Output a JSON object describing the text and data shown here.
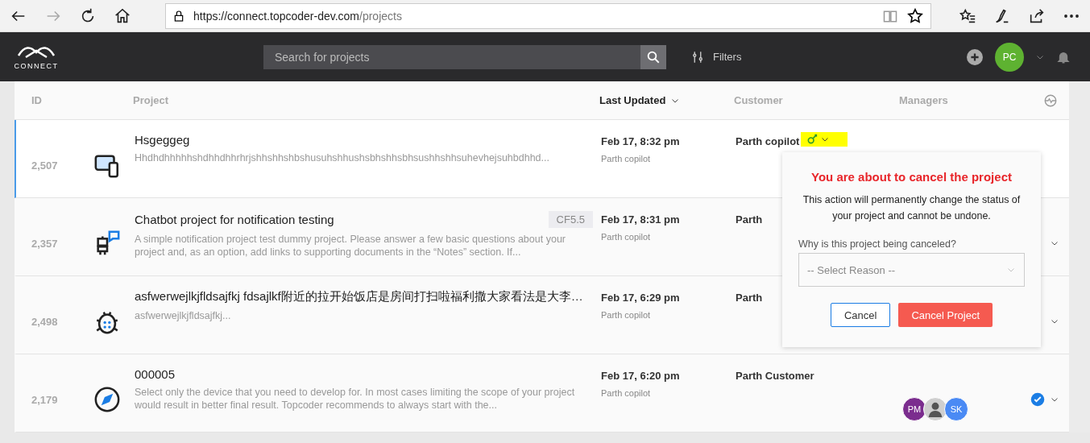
{
  "browser": {
    "url_host": "https://connect.topcoder-dev.com",
    "url_path": "/projects",
    "forward_disabled": true
  },
  "header": {
    "logo_text": "CONNECT",
    "search": {
      "placeholder": "Search for projects"
    },
    "filters_label": "Filters",
    "user_initials": "PC"
  },
  "table": {
    "columns": [
      {
        "label": "ID",
        "sorted": false
      },
      {
        "label": "Project",
        "sorted": false
      },
      {
        "label": "Last Updated",
        "sorted": true
      },
      {
        "label": "Customer",
        "sorted": false
      },
      {
        "label": "Managers",
        "sorted": false
      }
    ],
    "rows": [
      {
        "id": "2,507",
        "kind": "devices",
        "title": "Hsgeggeg",
        "description": "Hhdhdhhhhhshdhhdhhrhrjshhshhshbshusuhshhushsbhshhsbhsushhshhsuhevhejsuhbdhhd...",
        "updated": "Feb 17, 8:32 pm",
        "updated_by": "Parth copilot",
        "customer": "Parth copilot",
        "selected": true,
        "highlight_menu": true,
        "caret": false,
        "verified": false
      },
      {
        "id": "2,357",
        "kind": "chatbot",
        "title": "Chatbot project for notification testing",
        "tag": "CF5.5",
        "description": "A simple notification project test dummy project. Please answer a few basic questions about your project and, as an option, add links to supporting documents in the “Notes” section. If...",
        "updated": "Feb 17, 8:31 pm",
        "updated_by": "Parth copilot",
        "customer": "Parth",
        "selected": false,
        "highlight_menu": false,
        "caret": true,
        "verified": false
      },
      {
        "id": "2,498",
        "kind": "bug",
        "title": "asfwerwejlkjfldsajfkj fdsajlkf附近的拉开始饭店是房间打扫啦福利撒大家看法是大李…",
        "description": "asfwerwejlkjfldsajfkj...",
        "updated": "Feb 17, 6:29 pm",
        "updated_by": "Parth copilot",
        "customer": "Parth",
        "selected": false,
        "highlight_menu": false,
        "caret": true,
        "verified": false
      },
      {
        "id": "2,179",
        "kind": "compass",
        "title": "000005",
        "description": "Select only the device that you need to develop for. In most cases limiting the scope of your project would result in better final result. Topcoder recommends to always start with the...",
        "updated": "Feb 17, 6:20 pm",
        "updated_by": "Parth copilot",
        "customer": "Parth Customer",
        "selected": false,
        "highlight_menu": false,
        "caret": true,
        "verified": true,
        "managers": [
          {
            "kind": "initials",
            "initials": "PM",
            "color": "#7b2d8e"
          },
          {
            "kind": "photo"
          },
          {
            "kind": "initials",
            "initials": "SK",
            "color": "#4a8af4"
          }
        ]
      }
    ]
  },
  "dialog": {
    "title": "You are about to cancel the project",
    "message": "This action will permanently change the status of your project and cannot be undone.",
    "reason_label": "Why is this project being canceled?",
    "reason_select": {
      "placeholder": "-- Select Reason --"
    },
    "buttons": [
      {
        "label": "Cancel",
        "kind": "secondary"
      },
      {
        "label": "Cancel Project",
        "kind": "danger"
      }
    ]
  }
}
